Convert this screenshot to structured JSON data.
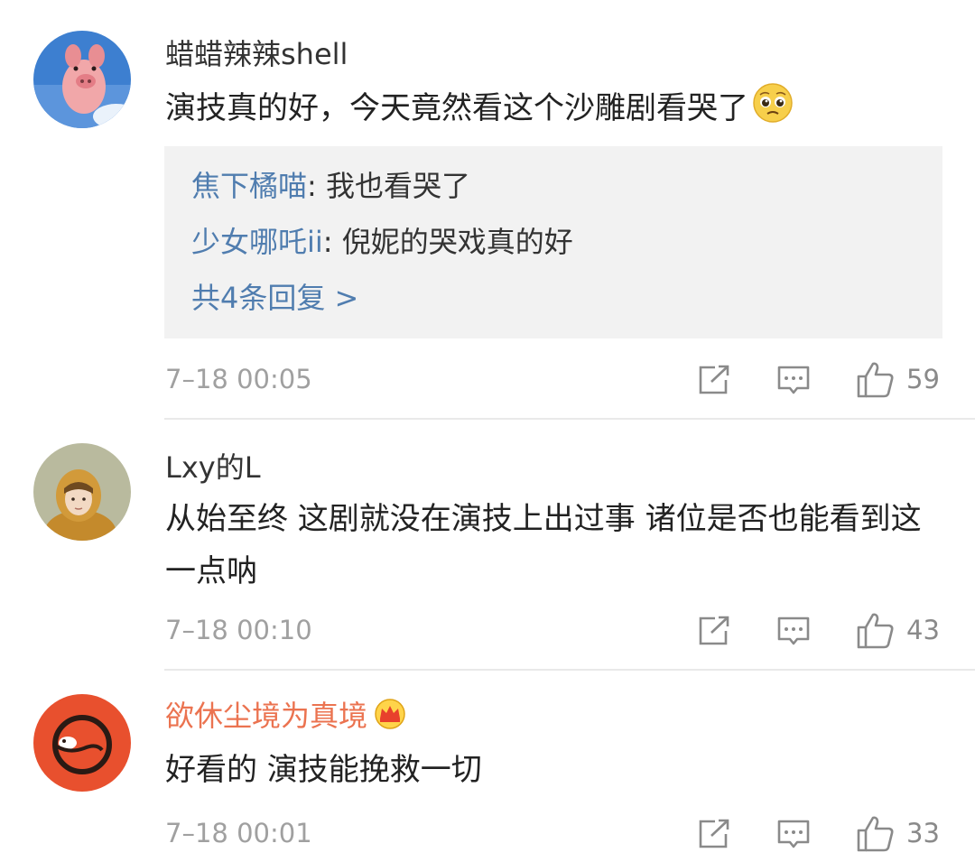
{
  "comments": [
    {
      "username": "蜡蜡辣辣shell",
      "text": "演技真的好，今天竟然看这个沙雕剧看哭了",
      "emoji": "pleading-face-emoji",
      "replies": [
        {
          "user": "焦下橘喵",
          "sep": ": ",
          "text": "我也看哭了"
        },
        {
          "user": "少女哪吒ii",
          "sep": ": ",
          "text": "倪妮的哭戏真的好"
        }
      ],
      "more_replies": "共4条回复 >",
      "time": "7–18 00:05",
      "likes": "59"
    },
    {
      "username": "Lxy的L",
      "text": "从始至终 这剧就没在演技上出过事  诸位是否也能看到这一点呐",
      "time": "7–18 00:10",
      "likes": "43"
    },
    {
      "username": "欲休尘境为真境",
      "vip_badge": "crown-icon",
      "text": "好看的 演技能挽救一切",
      "time": "7–18 00:01",
      "likes": "33"
    }
  ],
  "icons": {
    "share": "share-icon",
    "reply": "comment-icon",
    "like": "thumbs-up-icon"
  },
  "colors": {
    "link_blue": "#507daf",
    "vip_orange": "#eb7350",
    "meta_gray": "#a0a0a0",
    "reply_bg": "#f2f2f2"
  }
}
